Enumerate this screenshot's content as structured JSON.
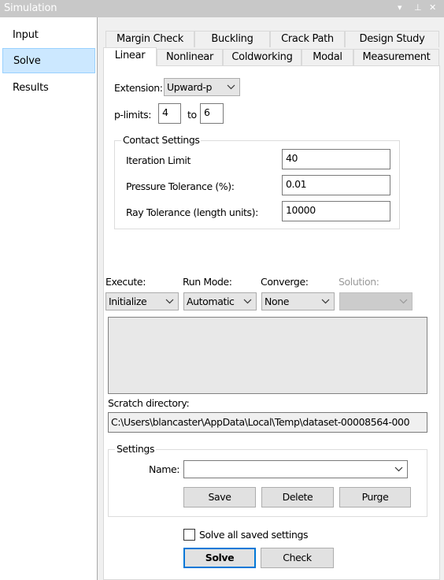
{
  "window": {
    "title": "Simulation"
  },
  "titlebar_controls": {
    "dropdown": "▾",
    "pin": "⊥",
    "close": "✕"
  },
  "nav": {
    "items": [
      {
        "label": "Input"
      },
      {
        "label": "Solve"
      },
      {
        "label": "Results"
      }
    ]
  },
  "tabs": {
    "row1": [
      "Margin Check",
      "Buckling",
      "Crack Path",
      "Design Study"
    ],
    "row2": [
      "Linear",
      "Nonlinear",
      "Coldworking",
      "Modal",
      "Measurement"
    ],
    "active": "Linear"
  },
  "form": {
    "extension_label": "Extension:",
    "extension_value": "Upward-p",
    "plimits_label": "p-limits:",
    "plimit_from": "4",
    "plimit_to_label": "to",
    "plimit_to": "6",
    "contact": {
      "title": "Contact Settings",
      "iteration_label": "Iteration Limit",
      "iteration_value": "40",
      "pressure_label": "Pressure Tolerance (%):",
      "pressure_value": "0.01",
      "ray_label": "Ray Tolerance (length units):",
      "ray_value": "10000"
    },
    "execute_label": "Execute:",
    "execute_value": "Initialize",
    "runmode_label": "Run Mode:",
    "runmode_value": "Automatic",
    "converge_label": "Converge:",
    "converge_value": "None",
    "solution_label": "Solution:",
    "solution_value": "",
    "scratch_label": "Scratch directory:",
    "scratch_value": "C:\\Users\\blancaster\\AppData\\Local\\Temp\\dataset-00008564-000",
    "settings": {
      "title": "Settings",
      "name_label": "Name:",
      "name_value": "",
      "save": "Save",
      "delete": "Delete",
      "purge": "Purge"
    },
    "solve_all_label": "Solve all saved settings",
    "solve_all_checked": false,
    "solve": "Solve",
    "check": "Check"
  }
}
